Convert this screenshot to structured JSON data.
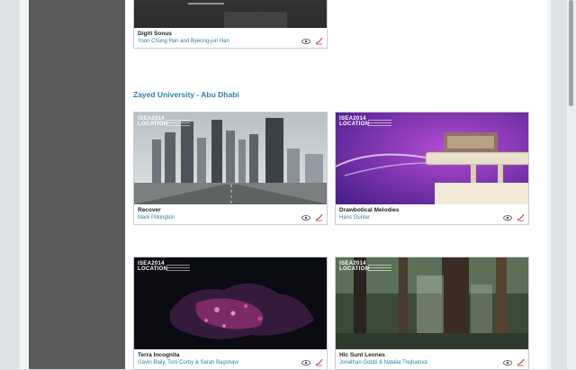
{
  "colors": {
    "accent": "#2b7fb0",
    "sidebar": "#5b5b5b"
  },
  "icons": {
    "left": "eye-logo-icon",
    "right": "swoosh-logo-icon"
  },
  "badge": {
    "line1": "ISEA2014",
    "line2": "LOCATION"
  },
  "section": {
    "title": "Zayed University - Abu Dhabi"
  },
  "cards": [
    {
      "title": "Digiti Sonus",
      "author": "Yoon Chung Han and Byeong-jun Han"
    },
    {
      "title": "Recover",
      "author": "Mark Pilkington"
    },
    {
      "title": "Drawbotical Melodies",
      "author": "Hans Gunter"
    },
    {
      "title": "Terra Incognita",
      "author": "Gavin Baily, Tom Corby & Sarah Bagshaw"
    },
    {
      "title": "Hic Sunt Leones",
      "author": "Jonathan Gobbi & Natalia Trejbalová"
    }
  ]
}
